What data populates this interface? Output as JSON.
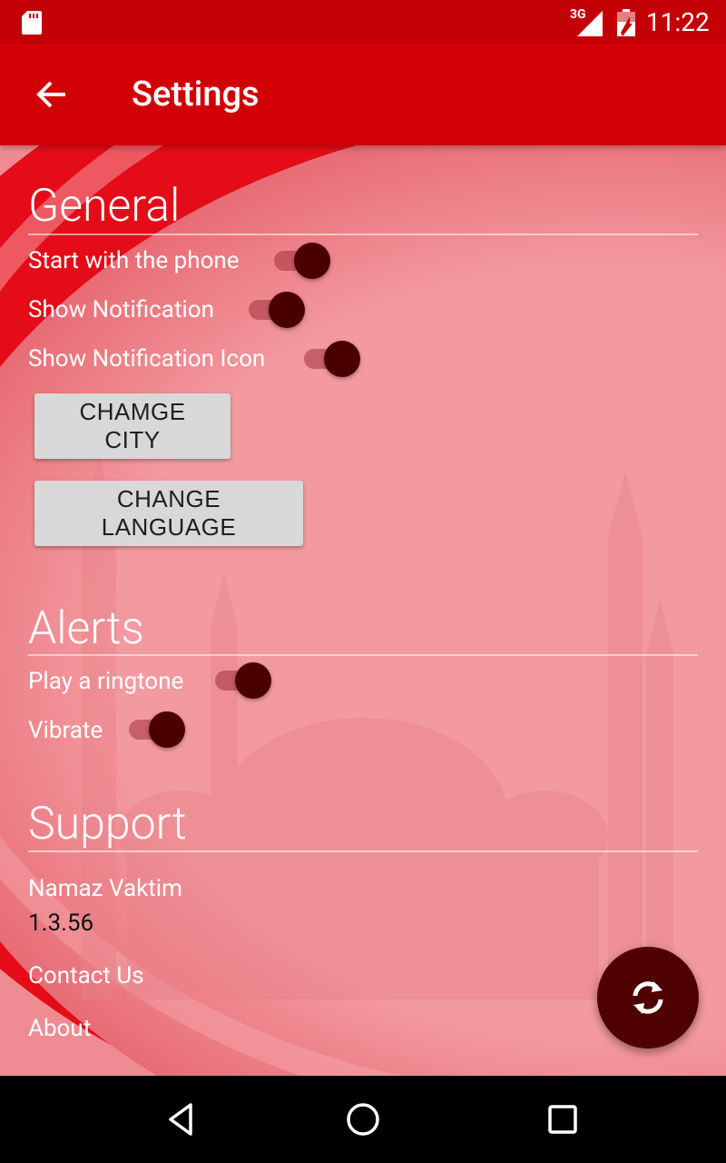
{
  "status_bar": {
    "network": "3G",
    "time": "11:22"
  },
  "app_bar": {
    "title": "Settings",
    "back_icon": "arrow-left-icon"
  },
  "sections": {
    "general": {
      "title": "General",
      "settings": [
        {
          "label": "Start with the phone",
          "enabled": true
        },
        {
          "label": "Show Notification",
          "enabled": true
        },
        {
          "label": "Show Notification Icon",
          "enabled": true
        }
      ],
      "buttons": {
        "change_city": "CHAMGE CITY",
        "change_language": "CHANGE LANGUAGE"
      }
    },
    "alerts": {
      "title": "Alerts",
      "settings": [
        {
          "label": "Play a ringtone",
          "enabled": true
        },
        {
          "label": "Vibrate",
          "enabled": true
        }
      ]
    },
    "support": {
      "title": "Support",
      "app_name": "Namaz Vaktim",
      "version": "1.3.56",
      "contact": "Contact Us",
      "about": "About"
    }
  },
  "fab_icon": "sync-icon",
  "nav_bar": {
    "icons": [
      "back-triangle-icon",
      "home-circle-icon",
      "recents-square-icon"
    ]
  },
  "colors": {
    "status_bar": "#c40007",
    "app_bar": "#d10007",
    "background": "#f09299",
    "switch_thumb": "#4a0000",
    "fab": "#4f0000"
  }
}
